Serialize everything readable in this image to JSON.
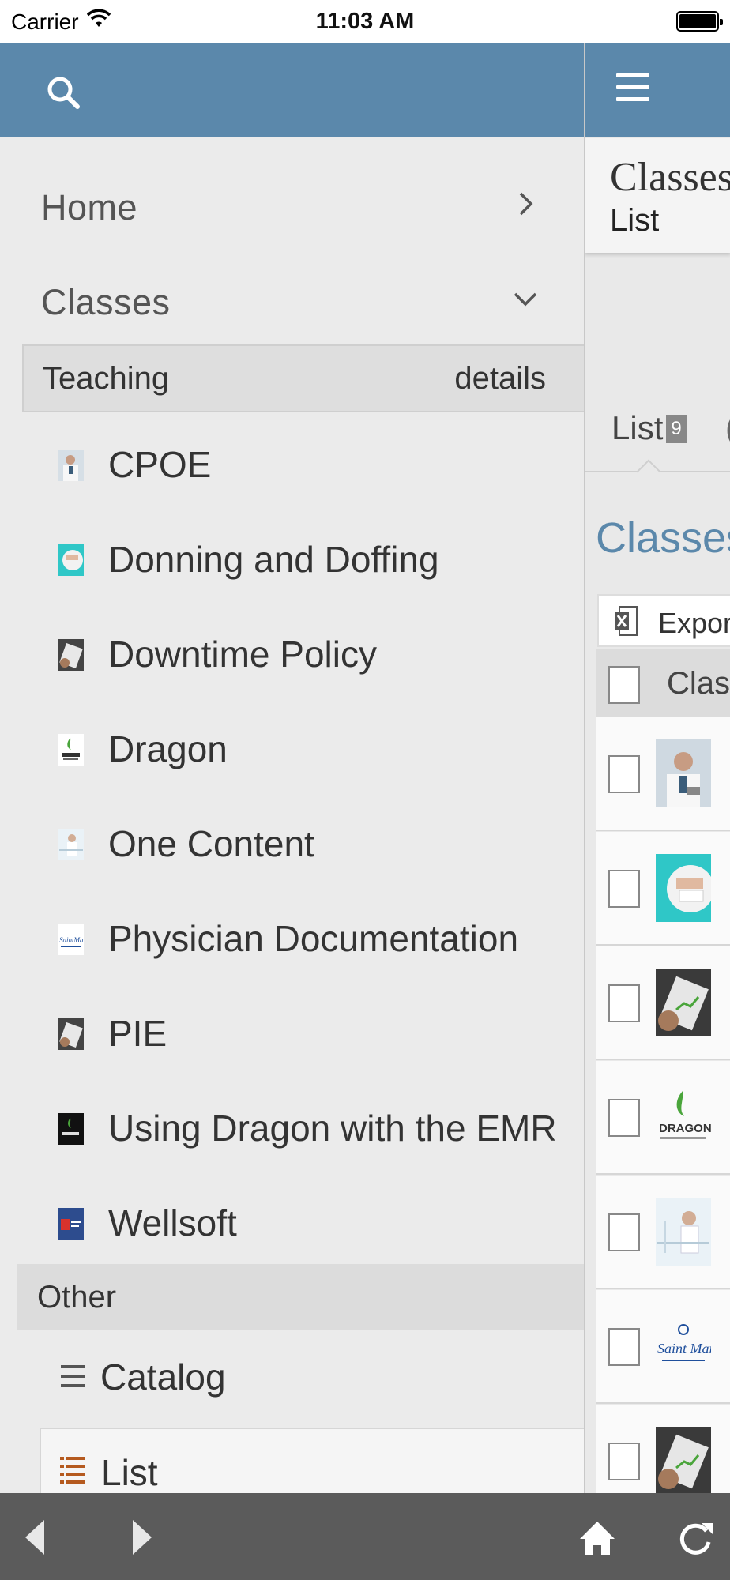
{
  "status_bar": {
    "carrier": "Carrier",
    "time": "11:03 AM"
  },
  "sidebar": {
    "nav": [
      {
        "label": "Home",
        "icon": "chevron-right-icon"
      },
      {
        "label": "Classes",
        "icon": "chevron-down-icon"
      }
    ],
    "teaching_header": {
      "label": "Teaching",
      "action": "details"
    },
    "classes": [
      {
        "name": "CPOE"
      },
      {
        "name": "Donning and Doffing"
      },
      {
        "name": "Downtime Policy"
      },
      {
        "name": "Dragon"
      },
      {
        "name": "One Content"
      },
      {
        "name": "Physician Documentation"
      },
      {
        "name": "PIE"
      },
      {
        "name": "Using Dragon with the EMR"
      },
      {
        "name": "Wellsoft"
      }
    ],
    "other_header": "Other",
    "sub_items": [
      {
        "name": "Catalog",
        "icon": "list-icon"
      },
      {
        "name": "List",
        "icon": "bulleted-list-icon"
      }
    ]
  },
  "main": {
    "title": "Classes",
    "subtitle": "List",
    "tab_label": "List",
    "tab_count": "9",
    "section_heading": "Classes",
    "export_label": "Export",
    "column_header": "Class"
  },
  "colors": {
    "header_blue": "#5b88ab",
    "toolbar_gray": "#5b5b5b",
    "sidebar_bg": "#ebebeb"
  },
  "toolbar": {
    "icons": [
      "back-icon",
      "forward-icon",
      "home-icon",
      "reload-icon"
    ]
  }
}
